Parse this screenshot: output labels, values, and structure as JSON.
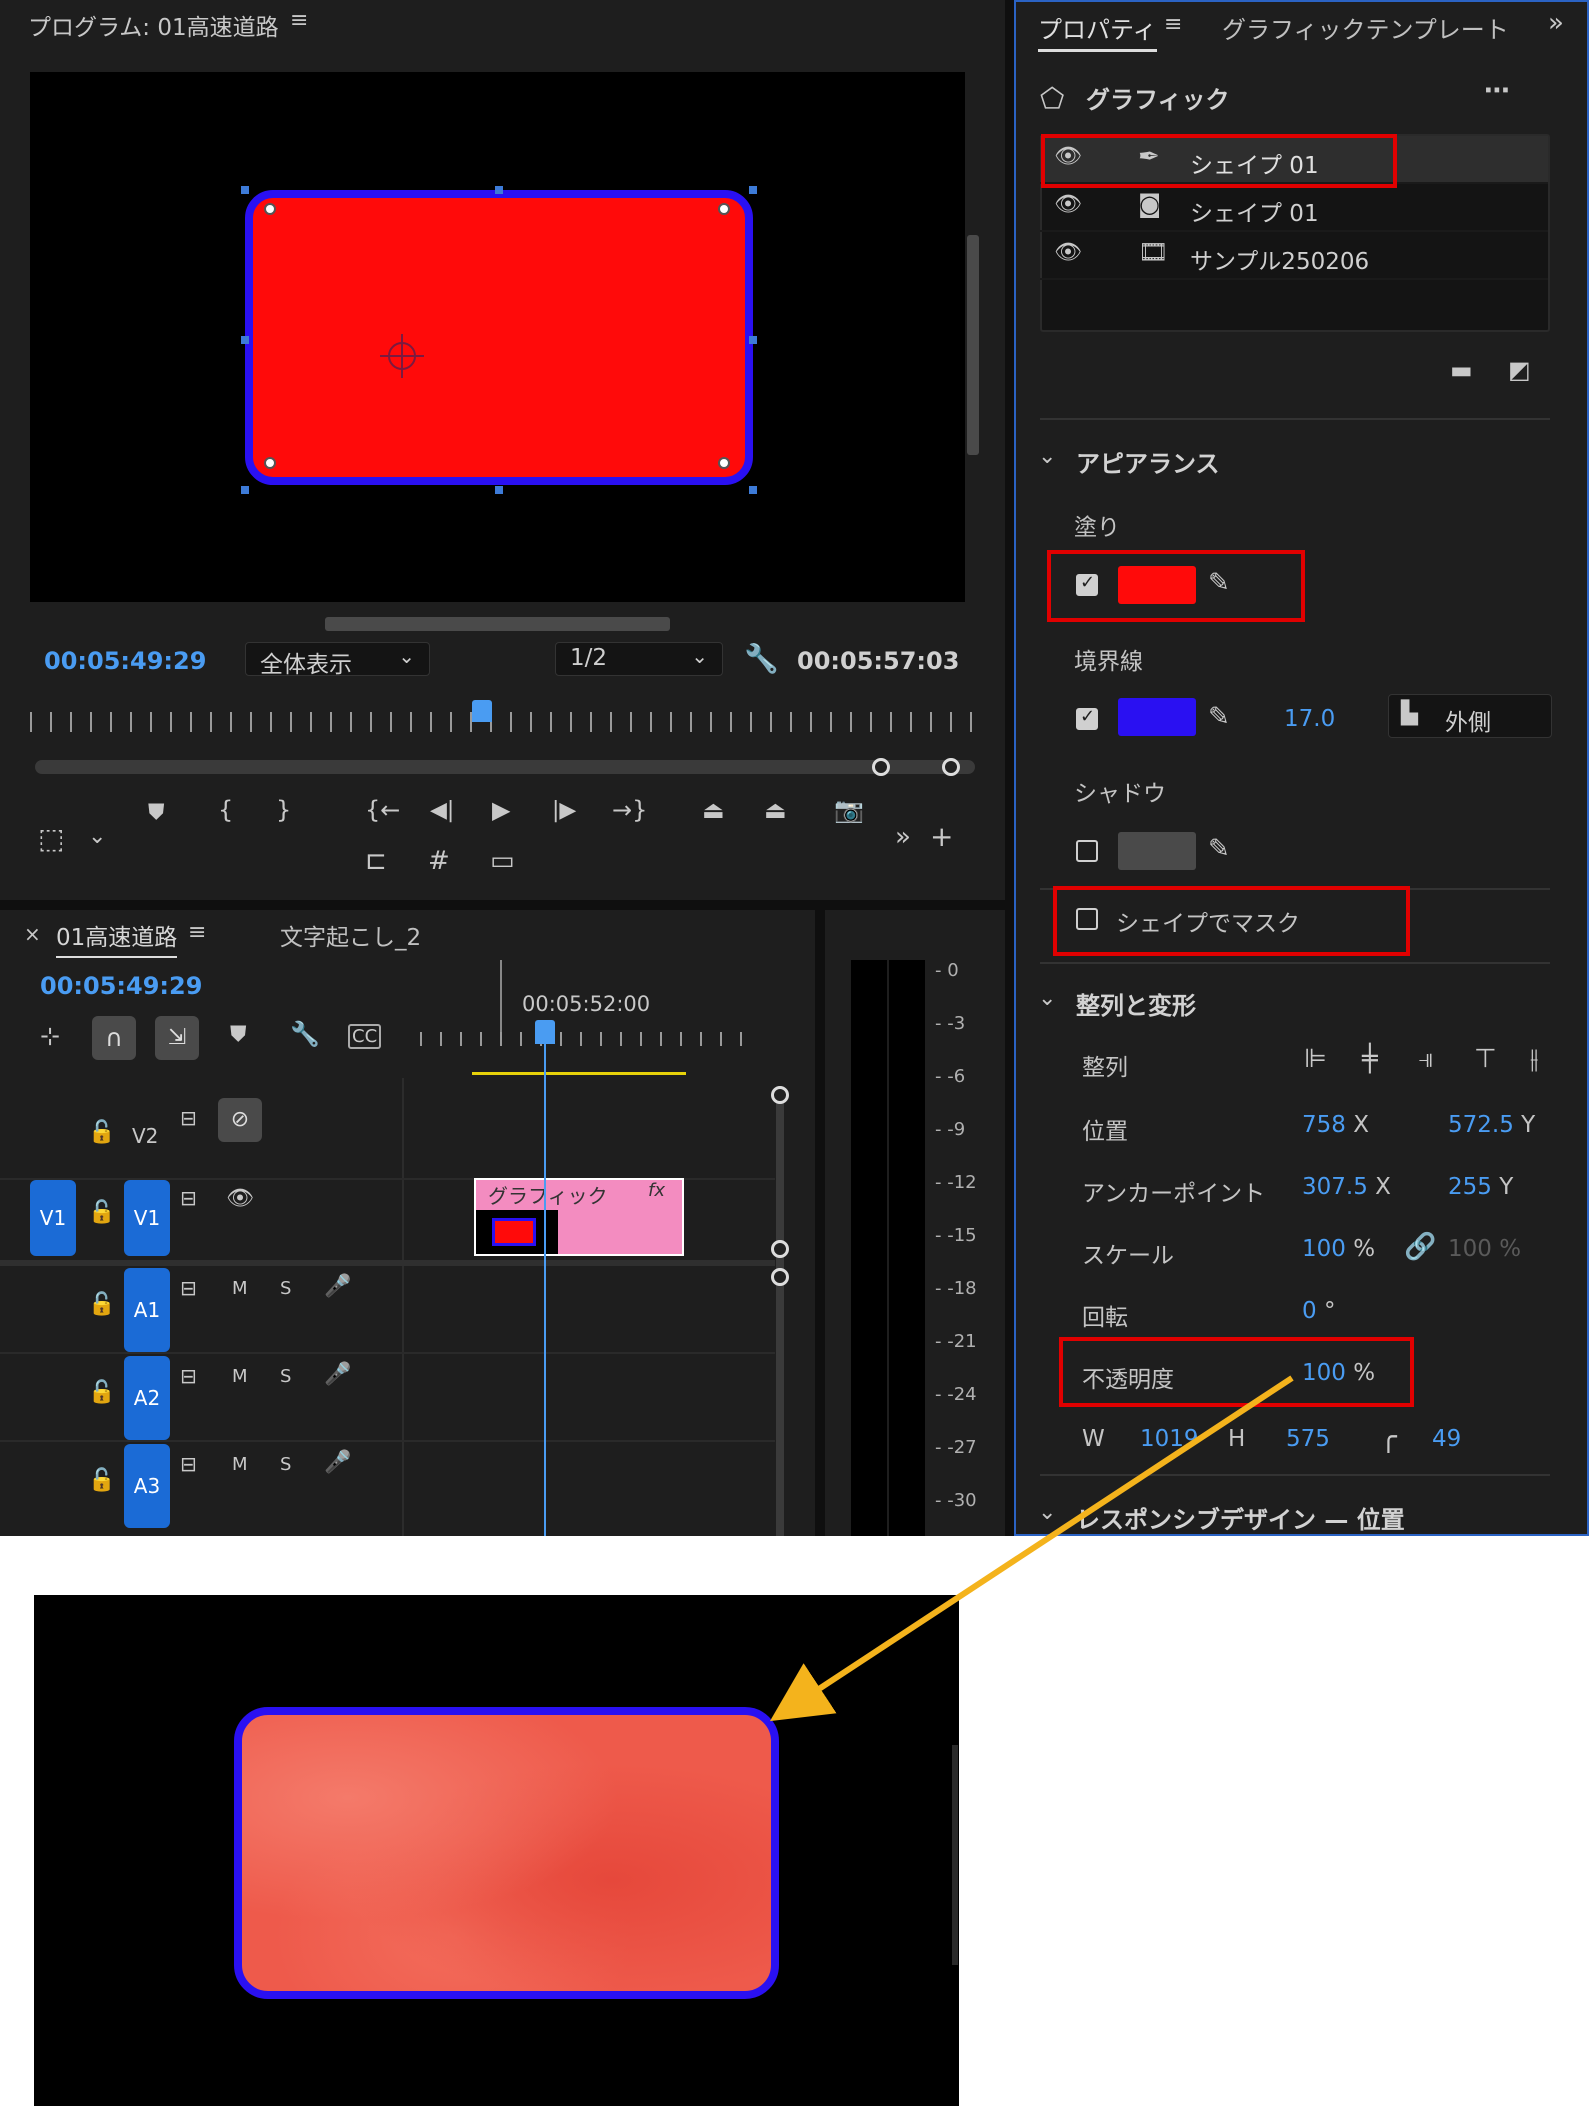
{
  "program_monitor": {
    "title": "プログラム: 01高速道路",
    "current_time": "00:05:49:29",
    "zoom": "全体表示",
    "resolution": "1/2",
    "duration": "00:05:57:03"
  },
  "timeline": {
    "tabs": [
      {
        "label": "01高速道路"
      },
      {
        "label": "文字起こし_2"
      }
    ],
    "current_time": "00:05:49:29",
    "ruler_time": "00:05:52:00",
    "tracks": {
      "v2": "V2",
      "v1_source": "V1",
      "v1": "V1",
      "a1": "A1",
      "a2": "A2",
      "a3": "A3",
      "mute": "M",
      "solo": "S"
    },
    "clip": {
      "label": "グラフィック",
      "fx": "fx"
    }
  },
  "audio_meter": {
    "scale": [
      "0",
      "-3",
      "-6",
      "-9",
      "-12",
      "-15",
      "-18",
      "-21",
      "-24",
      "-27",
      "-30"
    ]
  },
  "properties": {
    "tabs": [
      {
        "label": "プロパティ"
      },
      {
        "label": "グラフィックテンプレート"
      }
    ],
    "graphic_title": "グラフィック",
    "layers": [
      {
        "label": "シェイプ 01"
      },
      {
        "label": "シェイプ 01"
      },
      {
        "label": "サンプル250206"
      }
    ],
    "appearance": {
      "title": "アピアランス",
      "fill_label": "塗り",
      "stroke_label": "境界線",
      "stroke_width": "17.0",
      "stroke_position": "外側",
      "shadow_label": "シャドウ",
      "mask_label": "シェイプでマスク"
    },
    "align_transform": {
      "title": "整列と変形",
      "align_label": "整列",
      "position_label": "位置",
      "position_x": "758",
      "position_y": "572.5",
      "anchor_label": "アンカーポイント",
      "anchor_x": "307.5",
      "anchor_y": "255",
      "scale_label": "スケール",
      "scale_value": "100",
      "scale_value2": "100 %",
      "rotation_label": "回転",
      "rotation_value": "0",
      "opacity_label": "不透明度",
      "opacity_value": "100",
      "w_label": "W",
      "w_value": "1019",
      "h_label": "H",
      "h_value": "575",
      "corner_value": "49",
      "x_unit": "X",
      "y_unit": "Y",
      "percent": "%",
      "degree": "°"
    },
    "responsive_title": "レスポンシブデザイン — 位置"
  },
  "colors": {
    "fill": "#ff0a0a",
    "stroke": "#2a10f2",
    "highlight": "#e10000",
    "arrow": "#f4b31c",
    "accent": "#4a9cf2"
  }
}
